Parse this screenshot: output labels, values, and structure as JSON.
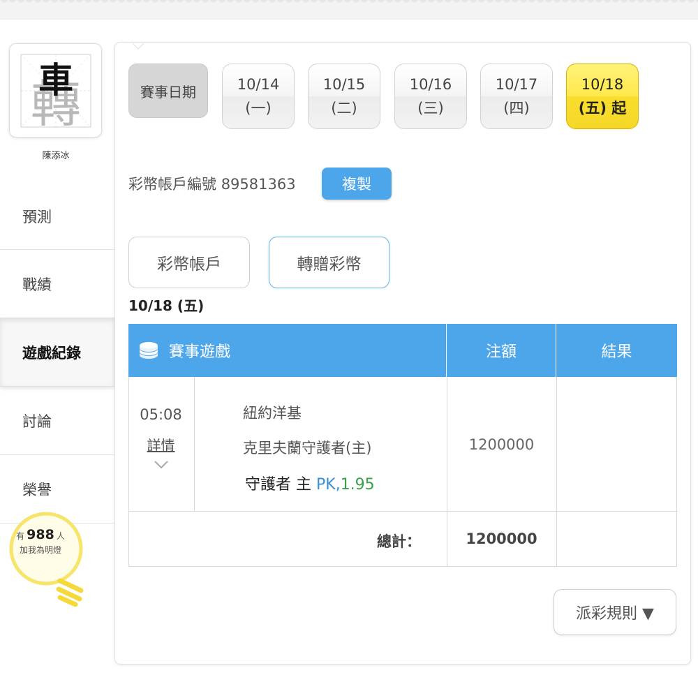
{
  "user": {
    "name": "陳添冰",
    "avatar_char_top": "車",
    "avatar_char_bottom": "轉"
  },
  "sidebar": {
    "items": [
      {
        "label": "預測"
      },
      {
        "label": "戰績"
      },
      {
        "label": "遊戲紀錄",
        "active": true
      },
      {
        "label": "討論"
      },
      {
        "label": "榮譽"
      }
    ],
    "fans": {
      "prefix": "有",
      "count": "988",
      "suffix": "人",
      "line2": "加我為明燈"
    }
  },
  "dates": {
    "label": "賽事日期",
    "items": [
      {
        "date": "10/14",
        "dow": "(一)",
        "active": false
      },
      {
        "date": "10/15",
        "dow": "(二)",
        "active": false
      },
      {
        "date": "10/16",
        "dow": "(三)",
        "active": false
      },
      {
        "date": "10/17",
        "dow": "(四)",
        "active": false
      },
      {
        "date": "10/18",
        "dow": "(五) 起",
        "active": true
      }
    ]
  },
  "account": {
    "label": "彩幣帳戶編號",
    "number": "89581363",
    "copy_label": "複製"
  },
  "tabs": [
    {
      "label": "彩幣帳戶"
    },
    {
      "label": "轉贈彩幣"
    }
  ],
  "selected_date": "10/18 (五)",
  "table": {
    "headers": {
      "game": "賽事遊戲",
      "stake": "注額",
      "result": "結果"
    },
    "rows": [
      {
        "time": "05:08",
        "detail_label": "詳情",
        "team_away": "紐約洋基",
        "team_home": "克里夫蘭守護者(主)",
        "pick_team": "守護者 主",
        "pick_type": "PK,",
        "pick_odds": "1.95",
        "stake": "1200000",
        "result": ""
      }
    ],
    "total_label": "總計：",
    "total_value": "1200000"
  },
  "rules_button": "派彩規則 ▼",
  "colors": {
    "accent": "#4da6ea",
    "active_date": "#ffe94a",
    "odds": "#3aa048",
    "pk": "#3b8fd6"
  }
}
